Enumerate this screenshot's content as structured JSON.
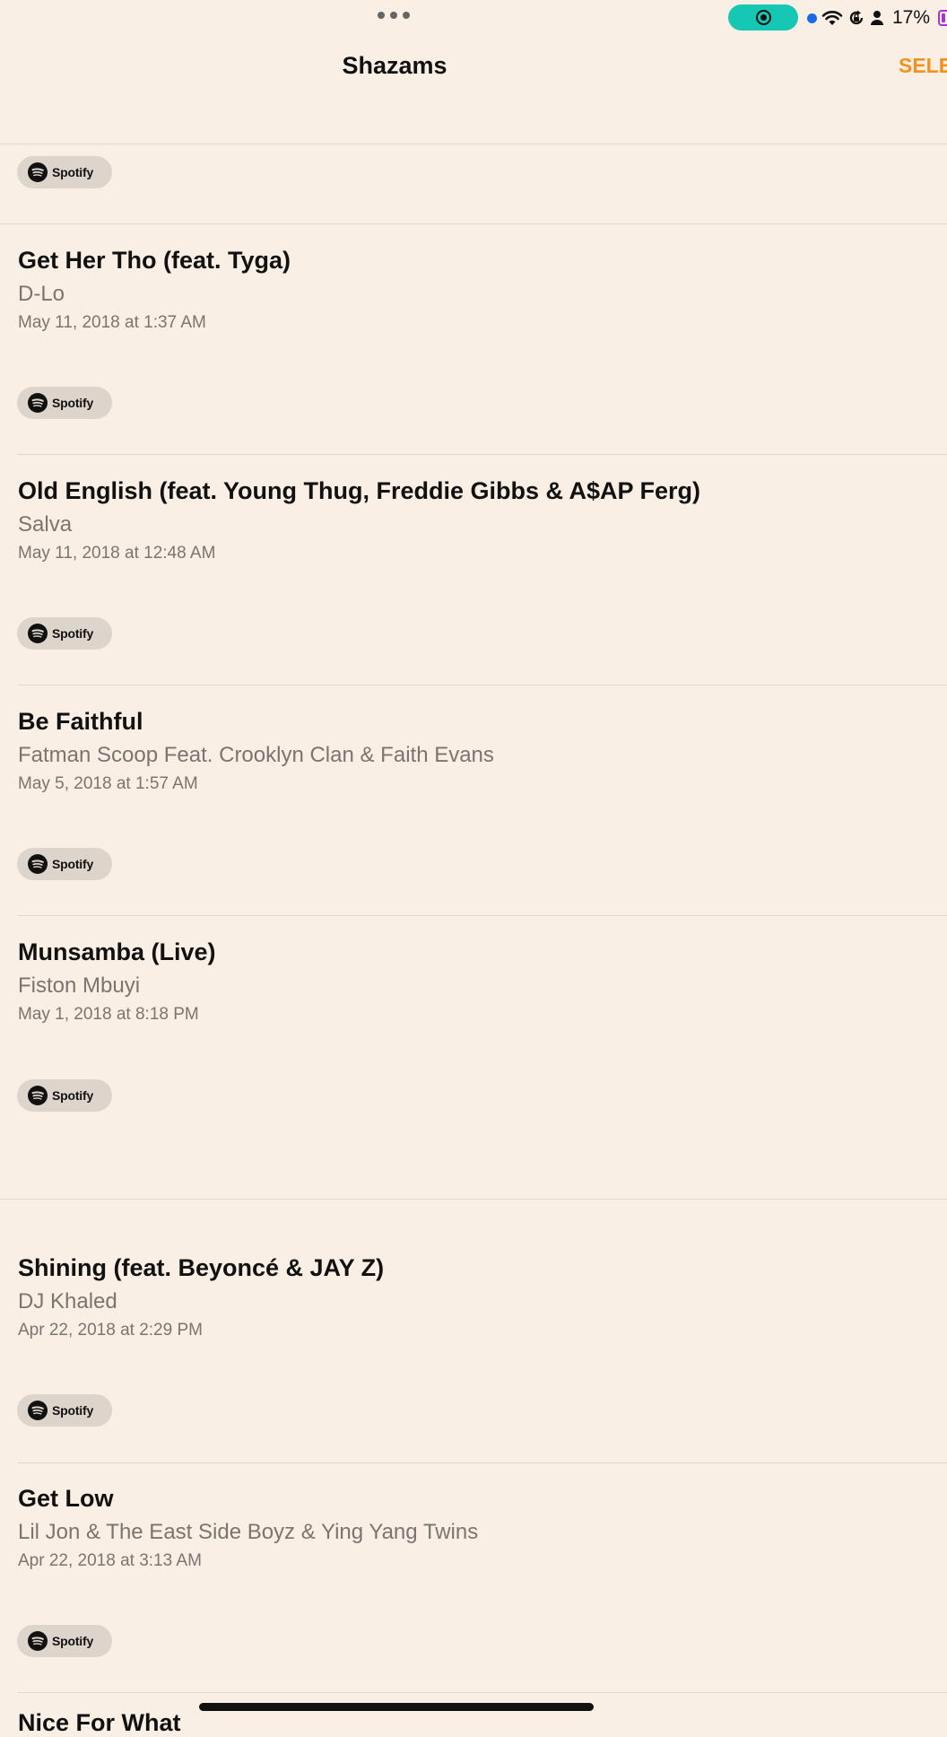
{
  "status_bar": {
    "battery_percent": "17%",
    "screen_recording": true,
    "colors": {
      "record_pill": "#16c8b4",
      "location_dot": "#1a6ae8",
      "battery": "#b030d0"
    },
    "icons": [
      "multitask-dots-icon",
      "screen-record-icon",
      "location-dot-icon",
      "wifi-icon",
      "orientation-lock-icon",
      "person-icon",
      "battery-icon"
    ]
  },
  "nav": {
    "title": "Shazams",
    "select_label": "SELECT",
    "accent_color": "#f0931e"
  },
  "spotify_label": "Spotify",
  "songs": [
    {
      "title": "Get Her Tho (feat. Tyga)",
      "artist": "D-Lo",
      "date": "May 11, 2018 at 1:37 AM"
    },
    {
      "title": "Old English (feat. Young Thug, Freddie Gibbs & A$AP Ferg)",
      "artist": "Salva",
      "date": "May 11, 2018 at 12:48 AM"
    },
    {
      "title": "Be Faithful",
      "artist": "Fatman Scoop Feat. Crooklyn Clan & Faith Evans",
      "date": "May 5, 2018 at 1:57 AM"
    },
    {
      "title": "Munsamba (Live)",
      "artist": "Fiston Mbuyi",
      "date": "May 1, 2018 at 8:18 PM"
    },
    {
      "title": "Shining (feat. Beyoncé & JAY Z)",
      "artist": "DJ Khaled",
      "date": "Apr 22, 2018 at 2:29 PM"
    },
    {
      "title": "Get Low",
      "artist": "Lil Jon & The East Side Boyz & Ying Yang Twins",
      "date": "Apr 22, 2018 at 3:13 AM"
    }
  ],
  "peek_title": "Nice For What"
}
